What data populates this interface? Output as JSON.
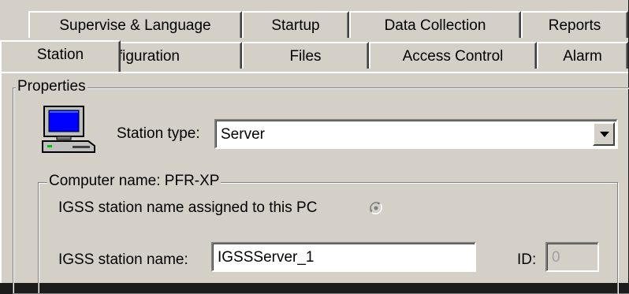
{
  "tabs_back": [
    {
      "label": "Supervise & Language"
    },
    {
      "label": "Startup"
    },
    {
      "label": "Data Collection"
    },
    {
      "label": "Reports"
    }
  ],
  "tabs_front": [
    {
      "label": "Station",
      "selected": true
    },
    {
      "label": "Configuration"
    },
    {
      "label": "Files"
    },
    {
      "label": "Access Control"
    },
    {
      "label": "Alarm"
    }
  ],
  "properties": {
    "title": "Properties",
    "station_type_label": "Station type:",
    "station_type_value": "Server",
    "station_icon": "computer-icon"
  },
  "computer_group": {
    "title": "Computer name: PFR-XP",
    "assigned_label": "IGSS station name assigned to this PC",
    "assigned_selected": true,
    "station_name_label": "IGSS station name:",
    "station_name_value": "IGSSServer_1",
    "id_label": "ID:",
    "id_value": "0"
  },
  "colors": {
    "face": "#d4d0c8",
    "highlight": "#ffffff",
    "shadow": "#808080",
    "dark_shadow": "#404040"
  }
}
